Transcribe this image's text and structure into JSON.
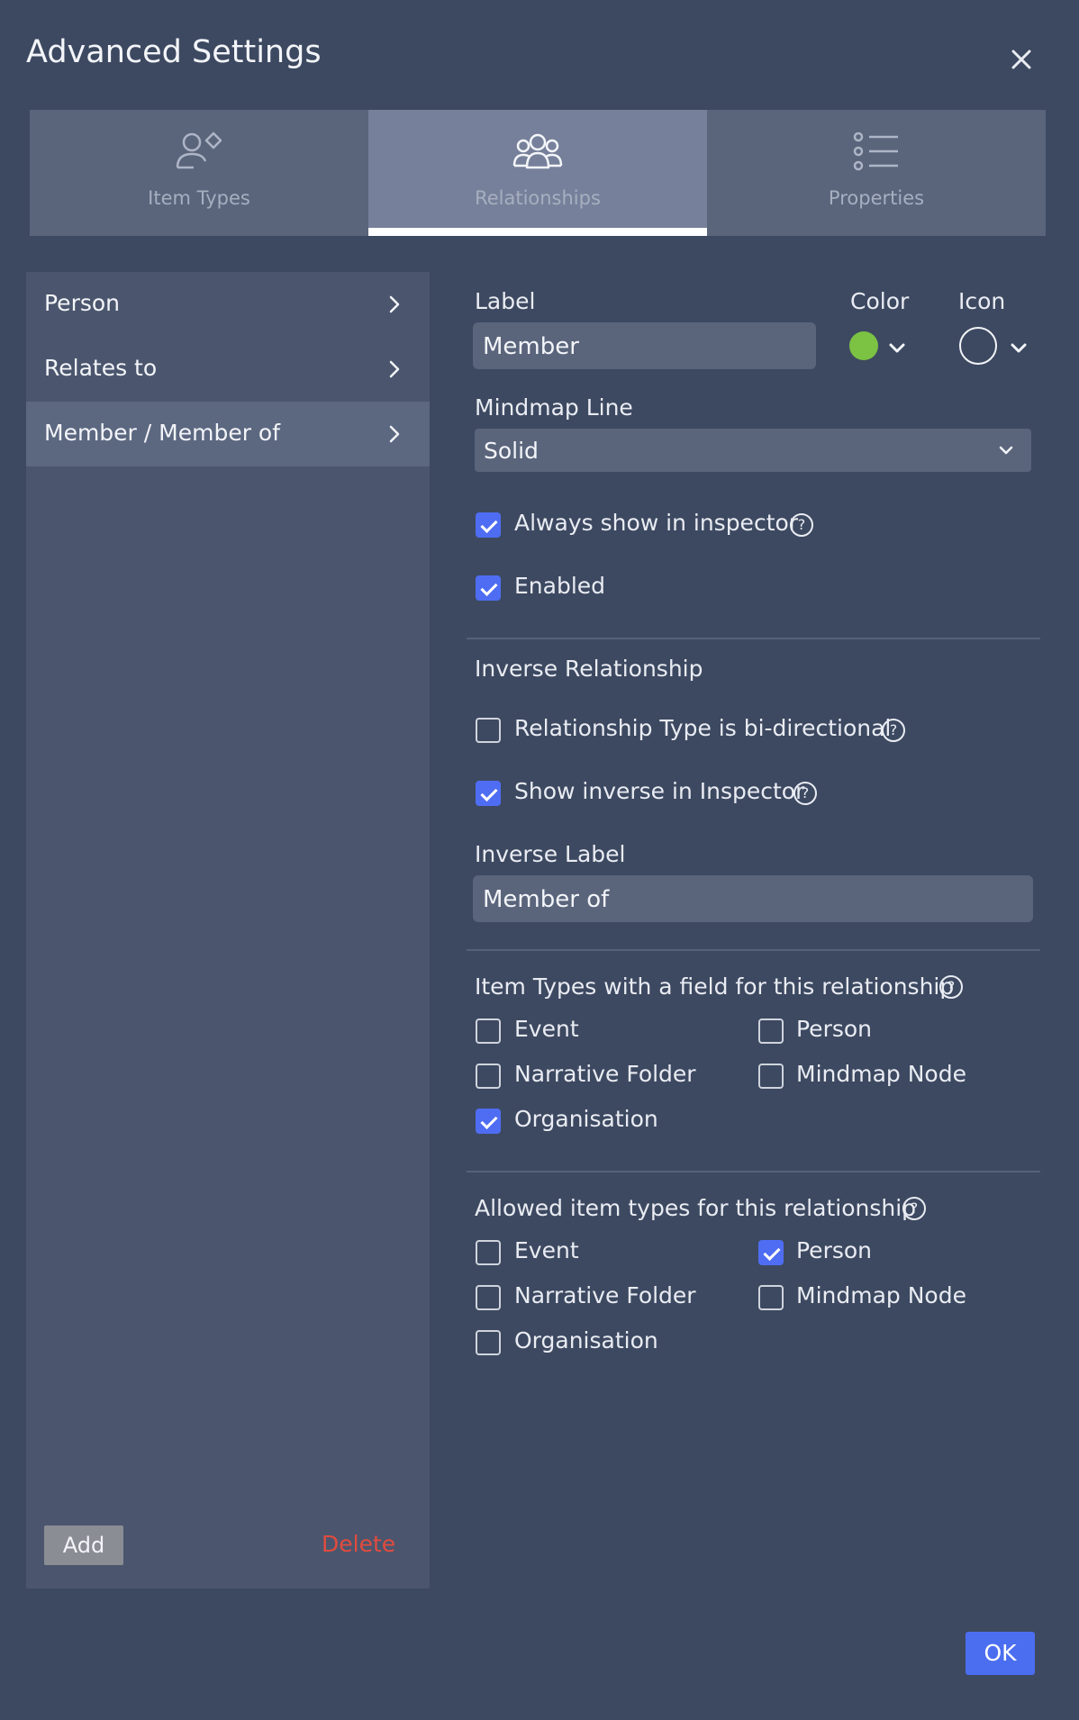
{
  "dialog": {
    "title": "Advanced Settings"
  },
  "tabs": [
    {
      "label": "Item Types",
      "icon": "person-diamond-icon",
      "active": false
    },
    {
      "label": "Relationships",
      "icon": "people-group-icon",
      "active": true
    },
    {
      "label": "Properties",
      "icon": "list-icon",
      "active": false
    }
  ],
  "relationships_list": [
    {
      "label": "Person",
      "selected": false
    },
    {
      "label": "Relates to",
      "selected": false
    },
    {
      "label": "Member / Member of",
      "selected": true
    }
  ],
  "left_actions": {
    "add_label": "Add",
    "delete_label": "Delete",
    "delete_color": "#e24b3e"
  },
  "form": {
    "label_heading": "Label",
    "label_value": "Member",
    "color_heading": "Color",
    "color_value": "#7cc243",
    "icon_heading": "Icon",
    "mindmap_heading": "Mindmap Line",
    "mindmap_value": "Solid",
    "always_show": {
      "label": "Always show in inspector",
      "checked": true
    },
    "enabled": {
      "label": "Enabled",
      "checked": true
    },
    "inverse_heading": "Inverse Relationship",
    "bidirectional": {
      "label": "Relationship Type is bi-directional",
      "checked": false
    },
    "show_inverse": {
      "label": "Show inverse in Inspector",
      "checked": true
    },
    "inverse_label_heading": "Inverse Label",
    "inverse_label_value": "Member of"
  },
  "field_types": {
    "heading": "Item Types with a field for this relationship",
    "options": [
      {
        "label": "Event",
        "checked": false
      },
      {
        "label": "Person",
        "checked": false
      },
      {
        "label": "Narrative Folder",
        "checked": false
      },
      {
        "label": "Mindmap Node",
        "checked": false
      },
      {
        "label": "Organisation",
        "checked": true
      }
    ]
  },
  "allowed_types": {
    "heading": "Allowed item types for this relationship",
    "options": [
      {
        "label": "Event",
        "checked": false
      },
      {
        "label": "Person",
        "checked": true
      },
      {
        "label": "Narrative Folder",
        "checked": false
      },
      {
        "label": "Mindmap Node",
        "checked": false
      },
      {
        "label": "Organisation",
        "checked": false
      }
    ]
  },
  "footer": {
    "ok_label": "OK",
    "accent": "#4b6ef0"
  }
}
